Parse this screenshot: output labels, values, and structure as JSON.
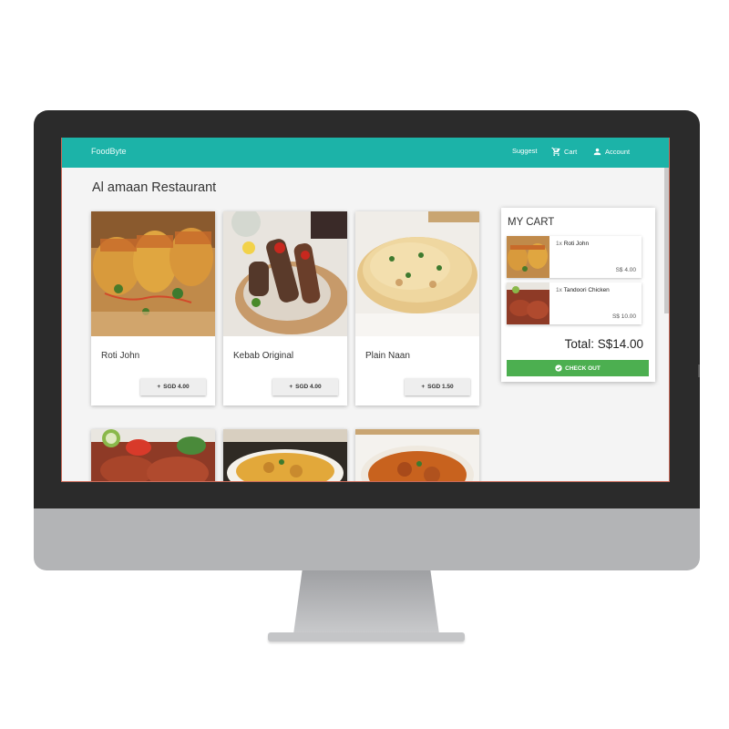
{
  "navbar": {
    "brand": "FoodByte",
    "suggest_label": "Suggest",
    "cart_label": "Cart",
    "account_label": "Account"
  },
  "page": {
    "title": "Al amaan Restaurant"
  },
  "menu": {
    "items": [
      {
        "name": "Roti John",
        "price_label": "SGD 4.00",
        "icon": "plus-icon"
      },
      {
        "name": "Kebab Original",
        "price_label": "SGD 4.00",
        "icon": "plus-icon"
      },
      {
        "name": "Plain Naan",
        "price_label": "SGD 1.50",
        "icon": "plus-icon"
      }
    ]
  },
  "cart": {
    "title": "MY CART",
    "items": [
      {
        "qty": "1x",
        "name": "Roti John",
        "price": "S$ 4.00"
      },
      {
        "qty": "1x",
        "name": "Tandoori Chicken",
        "price": "S$ 10.00"
      }
    ],
    "total_label": "Total: S$14.00",
    "checkout_label": "CHECK OUT"
  },
  "colors": {
    "navbar": "#1cb3a8",
    "checkout": "#4caf50"
  }
}
